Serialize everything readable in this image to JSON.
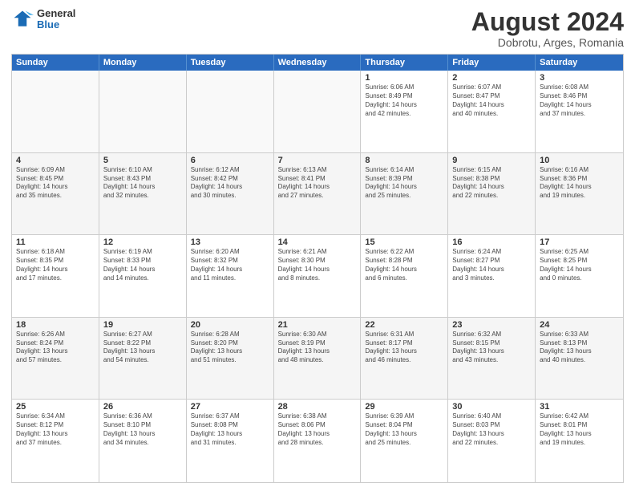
{
  "header": {
    "logo": {
      "general": "General",
      "blue": "Blue"
    },
    "title": "August 2024",
    "subtitle": "Dobrotu, Arges, Romania"
  },
  "calendar": {
    "days_of_week": [
      "Sunday",
      "Monday",
      "Tuesday",
      "Wednesday",
      "Thursday",
      "Friday",
      "Saturday"
    ],
    "weeks": [
      [
        {
          "day": "",
          "info": "",
          "empty": true
        },
        {
          "day": "",
          "info": "",
          "empty": true
        },
        {
          "day": "",
          "info": "",
          "empty": true
        },
        {
          "day": "",
          "info": "",
          "empty": true
        },
        {
          "day": "1",
          "info": "Sunrise: 6:06 AM\nSunset: 8:49 PM\nDaylight: 14 hours\nand 42 minutes."
        },
        {
          "day": "2",
          "info": "Sunrise: 6:07 AM\nSunset: 8:47 PM\nDaylight: 14 hours\nand 40 minutes."
        },
        {
          "day": "3",
          "info": "Sunrise: 6:08 AM\nSunset: 8:46 PM\nDaylight: 14 hours\nand 37 minutes."
        }
      ],
      [
        {
          "day": "4",
          "info": "Sunrise: 6:09 AM\nSunset: 8:45 PM\nDaylight: 14 hours\nand 35 minutes."
        },
        {
          "day": "5",
          "info": "Sunrise: 6:10 AM\nSunset: 8:43 PM\nDaylight: 14 hours\nand 32 minutes."
        },
        {
          "day": "6",
          "info": "Sunrise: 6:12 AM\nSunset: 8:42 PM\nDaylight: 14 hours\nand 30 minutes."
        },
        {
          "day": "7",
          "info": "Sunrise: 6:13 AM\nSunset: 8:41 PM\nDaylight: 14 hours\nand 27 minutes."
        },
        {
          "day": "8",
          "info": "Sunrise: 6:14 AM\nSunset: 8:39 PM\nDaylight: 14 hours\nand 25 minutes."
        },
        {
          "day": "9",
          "info": "Sunrise: 6:15 AM\nSunset: 8:38 PM\nDaylight: 14 hours\nand 22 minutes."
        },
        {
          "day": "10",
          "info": "Sunrise: 6:16 AM\nSunset: 8:36 PM\nDaylight: 14 hours\nand 19 minutes."
        }
      ],
      [
        {
          "day": "11",
          "info": "Sunrise: 6:18 AM\nSunset: 8:35 PM\nDaylight: 14 hours\nand 17 minutes."
        },
        {
          "day": "12",
          "info": "Sunrise: 6:19 AM\nSunset: 8:33 PM\nDaylight: 14 hours\nand 14 minutes."
        },
        {
          "day": "13",
          "info": "Sunrise: 6:20 AM\nSunset: 8:32 PM\nDaylight: 14 hours\nand 11 minutes."
        },
        {
          "day": "14",
          "info": "Sunrise: 6:21 AM\nSunset: 8:30 PM\nDaylight: 14 hours\nand 8 minutes."
        },
        {
          "day": "15",
          "info": "Sunrise: 6:22 AM\nSunset: 8:28 PM\nDaylight: 14 hours\nand 6 minutes."
        },
        {
          "day": "16",
          "info": "Sunrise: 6:24 AM\nSunset: 8:27 PM\nDaylight: 14 hours\nand 3 minutes."
        },
        {
          "day": "17",
          "info": "Sunrise: 6:25 AM\nSunset: 8:25 PM\nDaylight: 14 hours\nand 0 minutes."
        }
      ],
      [
        {
          "day": "18",
          "info": "Sunrise: 6:26 AM\nSunset: 8:24 PM\nDaylight: 13 hours\nand 57 minutes."
        },
        {
          "day": "19",
          "info": "Sunrise: 6:27 AM\nSunset: 8:22 PM\nDaylight: 13 hours\nand 54 minutes."
        },
        {
          "day": "20",
          "info": "Sunrise: 6:28 AM\nSunset: 8:20 PM\nDaylight: 13 hours\nand 51 minutes."
        },
        {
          "day": "21",
          "info": "Sunrise: 6:30 AM\nSunset: 8:19 PM\nDaylight: 13 hours\nand 48 minutes."
        },
        {
          "day": "22",
          "info": "Sunrise: 6:31 AM\nSunset: 8:17 PM\nDaylight: 13 hours\nand 46 minutes."
        },
        {
          "day": "23",
          "info": "Sunrise: 6:32 AM\nSunset: 8:15 PM\nDaylight: 13 hours\nand 43 minutes."
        },
        {
          "day": "24",
          "info": "Sunrise: 6:33 AM\nSunset: 8:13 PM\nDaylight: 13 hours\nand 40 minutes."
        }
      ],
      [
        {
          "day": "25",
          "info": "Sunrise: 6:34 AM\nSunset: 8:12 PM\nDaylight: 13 hours\nand 37 minutes."
        },
        {
          "day": "26",
          "info": "Sunrise: 6:36 AM\nSunset: 8:10 PM\nDaylight: 13 hours\nand 34 minutes."
        },
        {
          "day": "27",
          "info": "Sunrise: 6:37 AM\nSunset: 8:08 PM\nDaylight: 13 hours\nand 31 minutes."
        },
        {
          "day": "28",
          "info": "Sunrise: 6:38 AM\nSunset: 8:06 PM\nDaylight: 13 hours\nand 28 minutes."
        },
        {
          "day": "29",
          "info": "Sunrise: 6:39 AM\nSunset: 8:04 PM\nDaylight: 13 hours\nand 25 minutes."
        },
        {
          "day": "30",
          "info": "Sunrise: 6:40 AM\nSunset: 8:03 PM\nDaylight: 13 hours\nand 22 minutes."
        },
        {
          "day": "31",
          "info": "Sunrise: 6:42 AM\nSunset: 8:01 PM\nDaylight: 13 hours\nand 19 minutes."
        }
      ]
    ]
  }
}
